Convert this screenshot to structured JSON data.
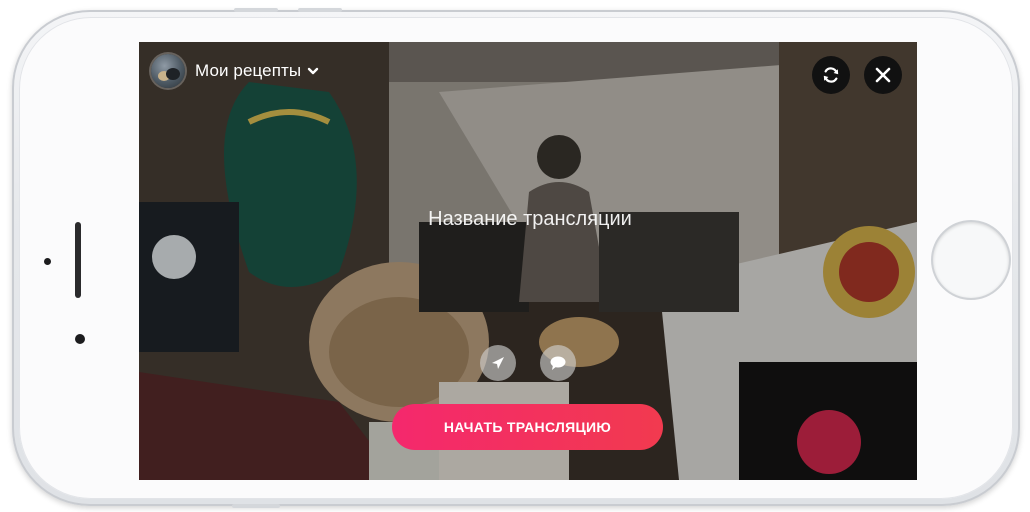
{
  "stream_setup": {
    "group_name": "Мои рецепты",
    "title_placeholder": "Название трансляции",
    "start_button_label": "НАЧАТЬ ТРАНСЛЯЦИЮ"
  },
  "icons": {
    "group_dropdown": "chevron-down-icon",
    "switch_camera": "camera-switch-icon",
    "close": "close-icon",
    "location": "location-arrow-icon",
    "comments": "speech-bubble-icon"
  },
  "colors": {
    "start_button": "#f23358",
    "icon_button_dark": "#111111",
    "icon_button_light": "#d2d2d2",
    "text": "#ffffff"
  }
}
